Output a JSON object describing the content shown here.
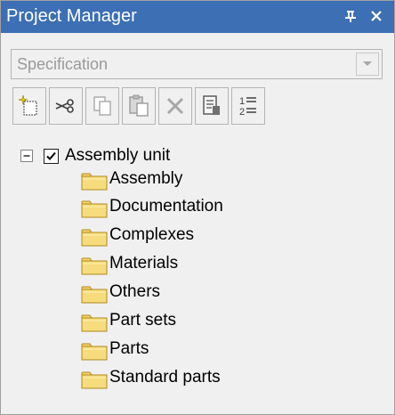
{
  "window": {
    "title": "Project Manager",
    "pin_icon": "pin-icon",
    "close_icon": "close-icon",
    "title_color": "#3c6fb3"
  },
  "combo": {
    "value": "Specification",
    "arrow_icon": "chevron-down-icon"
  },
  "toolbar": {
    "buttons": [
      {
        "icon": "new-object-icon"
      },
      {
        "icon": "cut-icon"
      },
      {
        "icon": "copy-icon"
      },
      {
        "icon": "paste-icon"
      },
      {
        "icon": "delete-icon"
      },
      {
        "icon": "properties-icon"
      },
      {
        "icon": "sort-icon"
      }
    ]
  },
  "tree": {
    "root": {
      "label": "Assembly unit",
      "expanded": true,
      "checked": true
    },
    "children": [
      {
        "label": "Assembly"
      },
      {
        "label": "Documentation"
      },
      {
        "label": "Complexes"
      },
      {
        "label": "Materials"
      },
      {
        "label": "Others"
      },
      {
        "label": "Part sets"
      },
      {
        "label": "Parts"
      },
      {
        "label": "Standard parts"
      }
    ],
    "folder_color": "#f4d46c"
  }
}
